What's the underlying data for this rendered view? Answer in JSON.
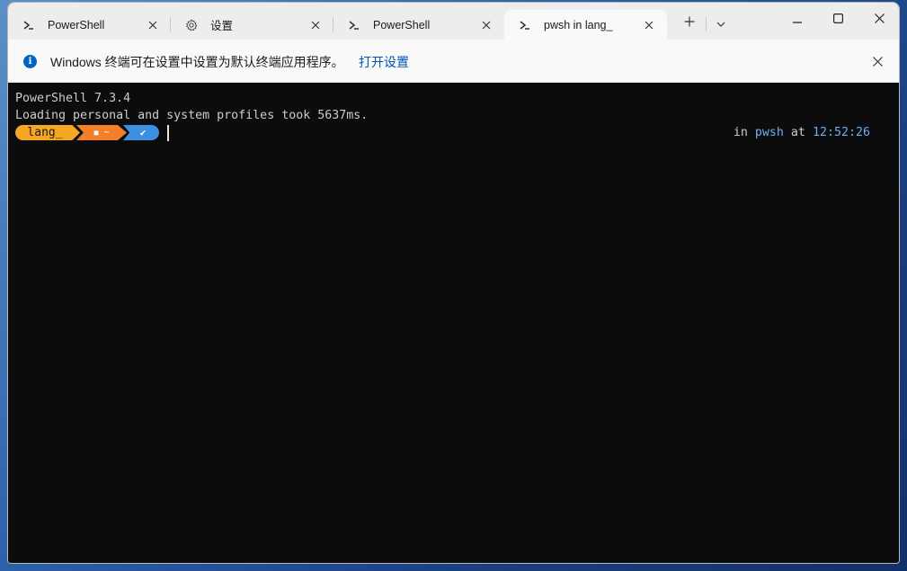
{
  "tabs": [
    {
      "label": "PowerShell",
      "icon": "powershell-icon"
    },
    {
      "label": "设置",
      "icon": "gear-icon"
    },
    {
      "label": "PowerShell",
      "icon": "powershell-icon"
    },
    {
      "label": "pwsh in lang_",
      "icon": "powershell-icon",
      "active": true
    }
  ],
  "infobar": {
    "message": "Windows 终端可在设置中设置为默认终端应用程序。",
    "link": "打开设置"
  },
  "terminal": {
    "lines": [
      "PowerShell 7.3.4",
      "Loading personal and system profiles took 5637ms."
    ],
    "prompt": {
      "segment1": "lang_",
      "segment2_folder": "■",
      "segment2_home": "~",
      "segment3_status": "✔"
    },
    "rprompt": {
      "in_word": "in",
      "shell": "pwsh",
      "at_word": "at",
      "time": "12:52:26"
    }
  },
  "colors": {
    "terminal_bg": "#0c0c0c",
    "terminal_fg": "#cccccc",
    "segment1": "#f5a623",
    "segment2": "#f37f2b",
    "segment3": "#3d8fe0",
    "accent_blue": "#6ab0f3",
    "link": "#0055b3"
  }
}
